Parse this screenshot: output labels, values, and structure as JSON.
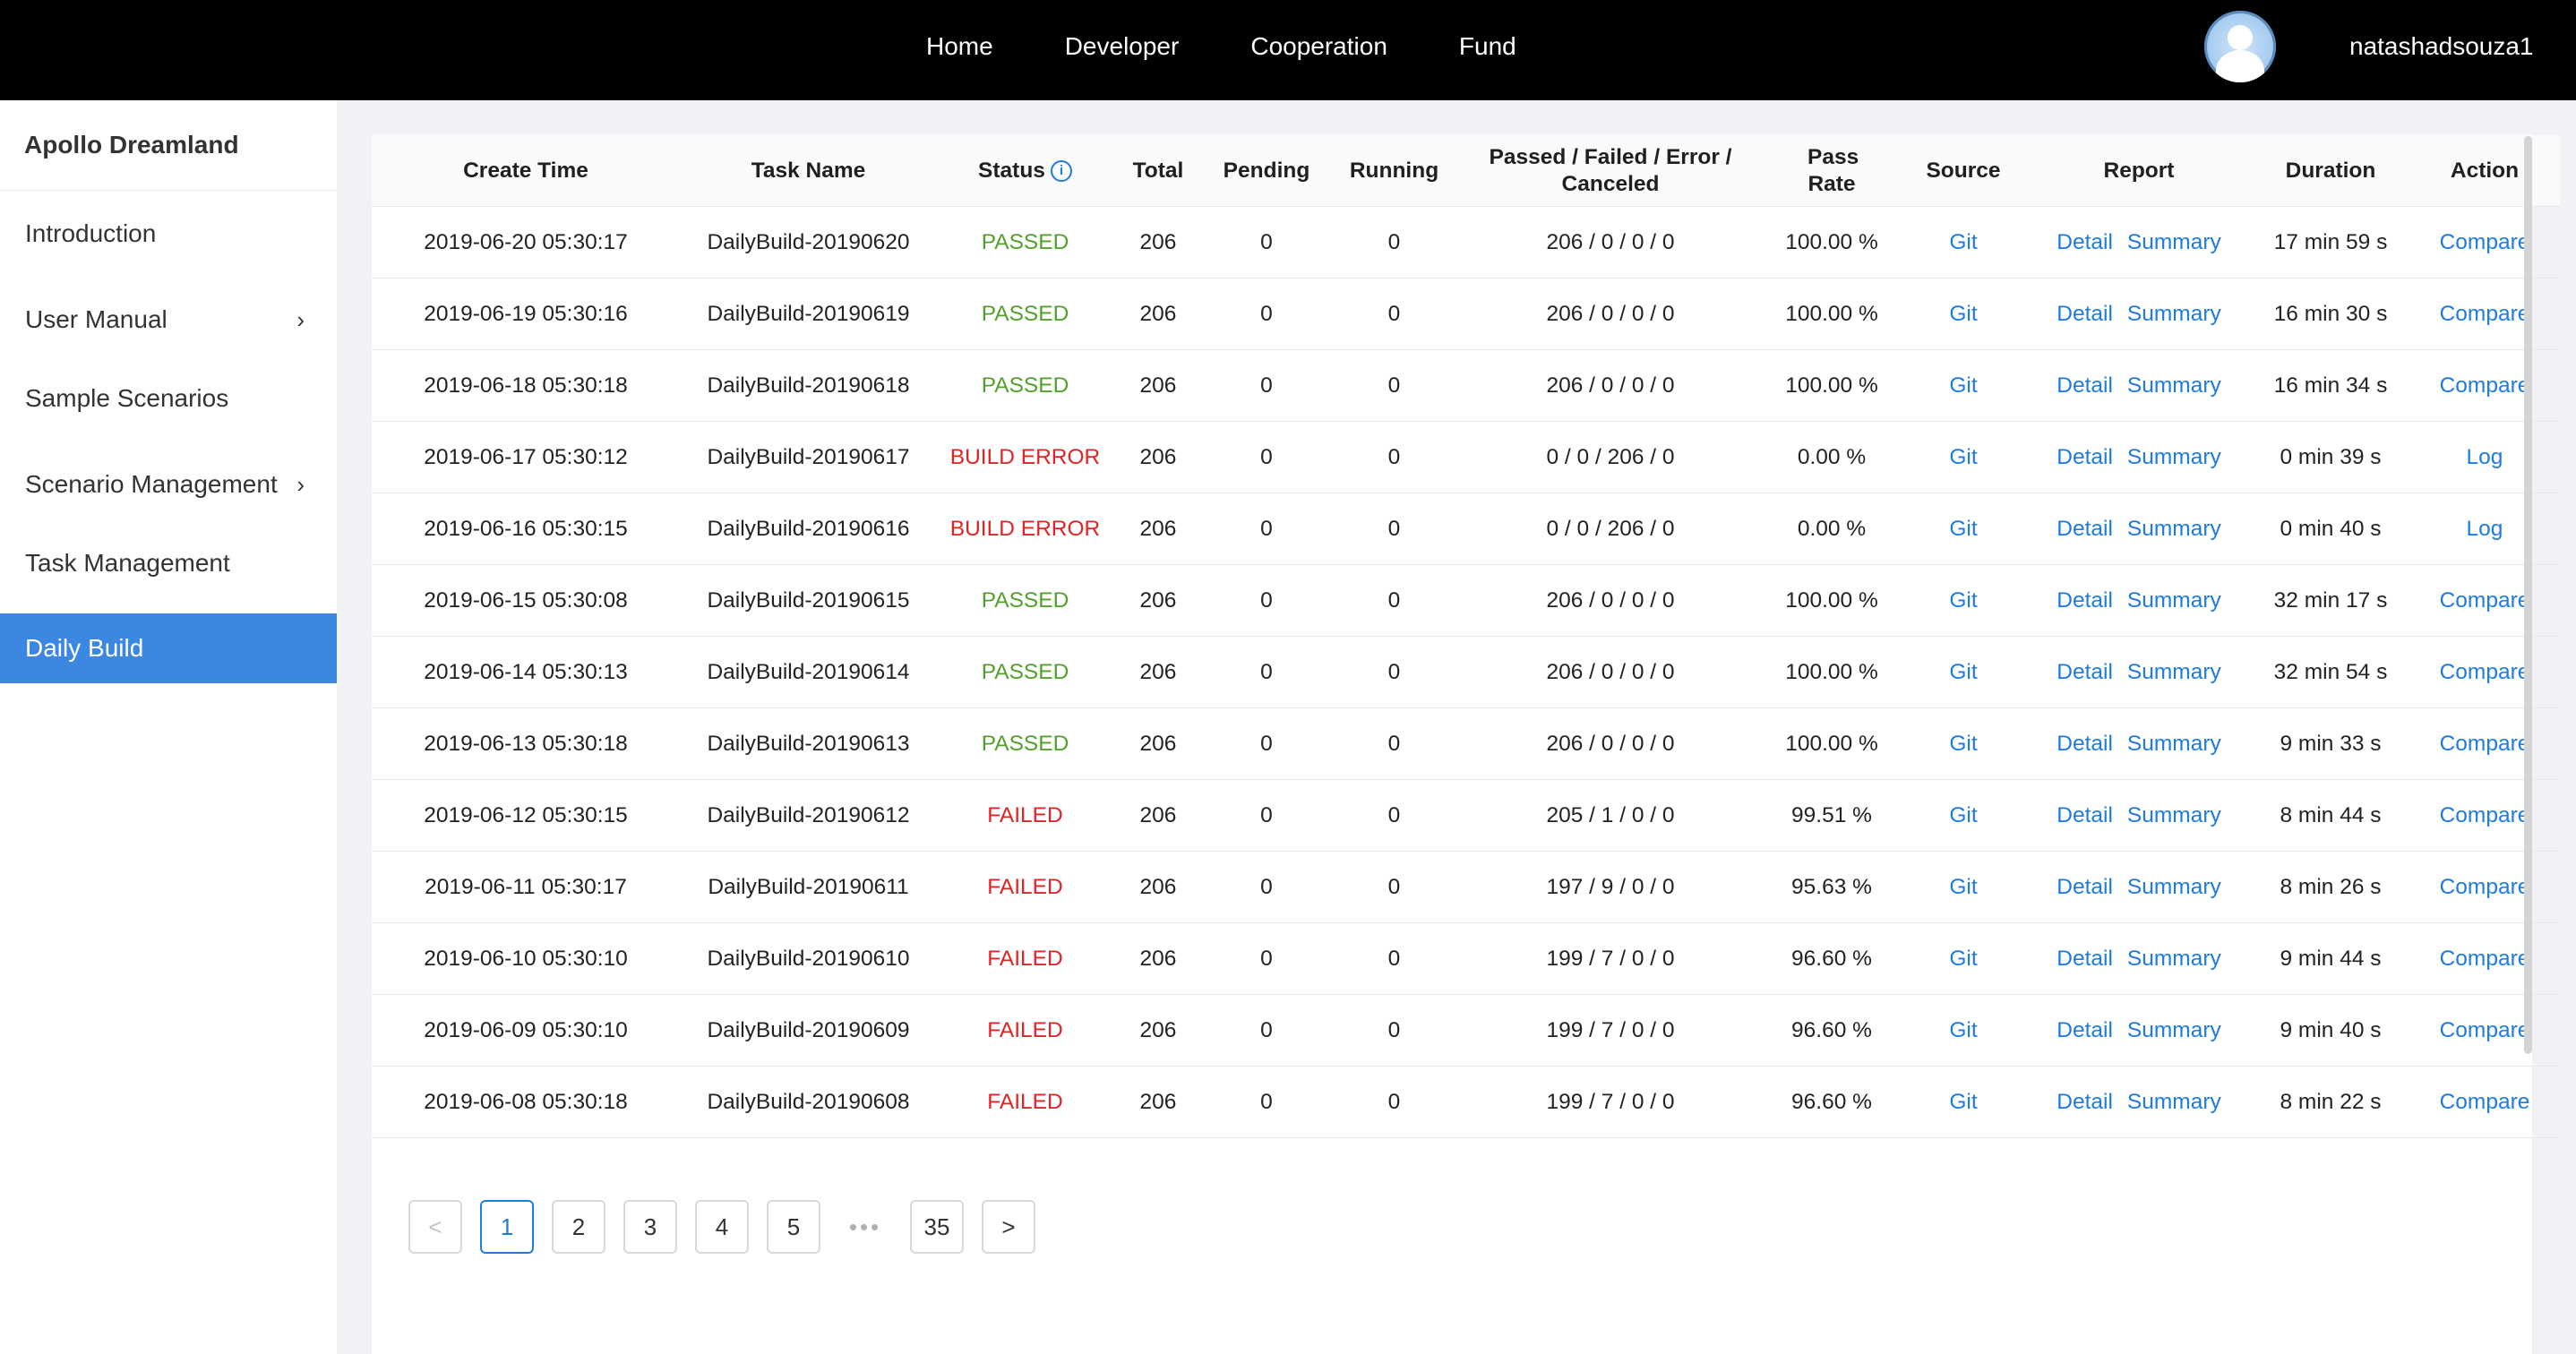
{
  "topnav": {
    "items": [
      "Home",
      "Developer",
      "Cooperation",
      "Fund"
    ],
    "username": "natashadsouza1"
  },
  "sidebar": {
    "title": "Apollo Dreamland",
    "items": [
      {
        "label": "Introduction",
        "has_arrow": false,
        "active": false
      },
      {
        "label": "User Manual",
        "has_arrow": true,
        "active": false
      },
      {
        "label": "Sample Scenarios",
        "has_arrow": false,
        "active": false
      },
      {
        "label": "Scenario Management",
        "has_arrow": true,
        "active": false
      },
      {
        "label": "Task Management",
        "has_arrow": false,
        "active": false
      },
      {
        "label": "Daily Build",
        "has_arrow": false,
        "active": true
      }
    ],
    "arrow_glyph": "›"
  },
  "table": {
    "columns": [
      "Create Time",
      "Task Name",
      "Status",
      "Total",
      "Pending",
      "Running",
      "Passed / Failed / Error / Canceled",
      "Pass Rate",
      "Source",
      "Report",
      "Duration",
      "Action"
    ],
    "status_info_glyph": "i",
    "report_links": [
      "Detail",
      "Summary"
    ],
    "rows": [
      {
        "create_time": "2019-06-20 05:30:17",
        "task_name": "DailyBuild-20190620",
        "status": "PASSED",
        "total": "206",
        "pending": "0",
        "running": "0",
        "pfec": "206 / 0 / 0 / 0",
        "pass_rate": "100.00 %",
        "source": "Git",
        "duration": "17 min 59 s",
        "action": "Compare"
      },
      {
        "create_time": "2019-06-19 05:30:16",
        "task_name": "DailyBuild-20190619",
        "status": "PASSED",
        "total": "206",
        "pending": "0",
        "running": "0",
        "pfec": "206 / 0 / 0 / 0",
        "pass_rate": "100.00 %",
        "source": "Git",
        "duration": "16 min 30 s",
        "action": "Compare"
      },
      {
        "create_time": "2019-06-18 05:30:18",
        "task_name": "DailyBuild-20190618",
        "status": "PASSED",
        "total": "206",
        "pending": "0",
        "running": "0",
        "pfec": "206 / 0 / 0 / 0",
        "pass_rate": "100.00 %",
        "source": "Git",
        "duration": "16 min 34 s",
        "action": "Compare"
      },
      {
        "create_time": "2019-06-17 05:30:12",
        "task_name": "DailyBuild-20190617",
        "status": "BUILD ERROR",
        "total": "206",
        "pending": "0",
        "running": "0",
        "pfec": "0 / 0 / 206 / 0",
        "pass_rate": "0.00 %",
        "source": "Git",
        "duration": "0 min 39 s",
        "action": "Log"
      },
      {
        "create_time": "2019-06-16 05:30:15",
        "task_name": "DailyBuild-20190616",
        "status": "BUILD ERROR",
        "total": "206",
        "pending": "0",
        "running": "0",
        "pfec": "0 / 0 / 206 / 0",
        "pass_rate": "0.00 %",
        "source": "Git",
        "duration": "0 min 40 s",
        "action": "Log"
      },
      {
        "create_time": "2019-06-15 05:30:08",
        "task_name": "DailyBuild-20190615",
        "status": "PASSED",
        "total": "206",
        "pending": "0",
        "running": "0",
        "pfec": "206 / 0 / 0 / 0",
        "pass_rate": "100.00 %",
        "source": "Git",
        "duration": "32 min 17 s",
        "action": "Compare"
      },
      {
        "create_time": "2019-06-14 05:30:13",
        "task_name": "DailyBuild-20190614",
        "status": "PASSED",
        "total": "206",
        "pending": "0",
        "running": "0",
        "pfec": "206 / 0 / 0 / 0",
        "pass_rate": "100.00 %",
        "source": "Git",
        "duration": "32 min 54 s",
        "action": "Compare"
      },
      {
        "create_time": "2019-06-13 05:30:18",
        "task_name": "DailyBuild-20190613",
        "status": "PASSED",
        "total": "206",
        "pending": "0",
        "running": "0",
        "pfec": "206 / 0 / 0 / 0",
        "pass_rate": "100.00 %",
        "source": "Git",
        "duration": "9 min 33 s",
        "action": "Compare"
      },
      {
        "create_time": "2019-06-12 05:30:15",
        "task_name": "DailyBuild-20190612",
        "status": "FAILED",
        "total": "206",
        "pending": "0",
        "running": "0",
        "pfec": "205 / 1 / 0 / 0",
        "pass_rate": "99.51 %",
        "source": "Git",
        "duration": "8 min 44 s",
        "action": "Compare"
      },
      {
        "create_time": "2019-06-11 05:30:17",
        "task_name": "DailyBuild-20190611",
        "status": "FAILED",
        "total": "206",
        "pending": "0",
        "running": "0",
        "pfec": "197 / 9 / 0 / 0",
        "pass_rate": "95.63 %",
        "source": "Git",
        "duration": "8 min 26 s",
        "action": "Compare"
      },
      {
        "create_time": "2019-06-10 05:30:10",
        "task_name": "DailyBuild-20190610",
        "status": "FAILED",
        "total": "206",
        "pending": "0",
        "running": "0",
        "pfec": "199 / 7 / 0 / 0",
        "pass_rate": "96.60 %",
        "source": "Git",
        "duration": "9 min 44 s",
        "action": "Compare"
      },
      {
        "create_time": "2019-06-09 05:30:10",
        "task_name": "DailyBuild-20190609",
        "status": "FAILED",
        "total": "206",
        "pending": "0",
        "running": "0",
        "pfec": "199 / 7 / 0 / 0",
        "pass_rate": "96.60 %",
        "source": "Git",
        "duration": "9 min 40 s",
        "action": "Compare"
      },
      {
        "create_time": "2019-06-08 05:30:18",
        "task_name": "DailyBuild-20190608",
        "status": "FAILED",
        "total": "206",
        "pending": "0",
        "running": "0",
        "pfec": "199 / 7 / 0 / 0",
        "pass_rate": "96.60 %",
        "source": "Git",
        "duration": "8 min 22 s",
        "action": "Compare"
      }
    ]
  },
  "pagination": {
    "prev_glyph": "<",
    "next_glyph": ">",
    "ellipsis": "•••",
    "pages": [
      "1",
      "2",
      "3",
      "4",
      "5"
    ],
    "last_page": "35",
    "current": "1"
  },
  "colors": {
    "topbar": "#000000",
    "sidebar_active": "#3b87e1",
    "link": "#1d7ce0",
    "passed": "#52a12a",
    "failed": "#e02424",
    "main_bg": "#f0f2f5"
  }
}
